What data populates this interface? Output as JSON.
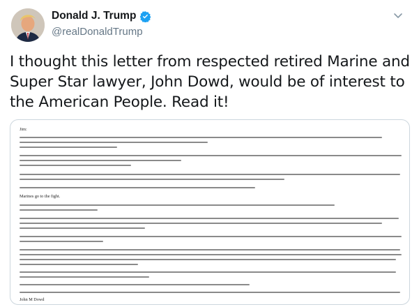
{
  "tweet": {
    "display_name": "Donald J. Trump",
    "handle": "@realDonaldTrump",
    "text": "I thought this letter from respected retired Marine and Super Star lawyer, John Dowd, would be of interest to the American People. Read it!"
  },
  "letter": {
    "salutation": "Jim:",
    "fight_line": "Marines go to the fight.",
    "signature": "John M Dowd"
  },
  "colors": {
    "verified": "#1da1f2",
    "handle": "#657786",
    "border": "#ccd6dd"
  },
  "icons": {
    "verified": "verified-badge-icon",
    "menu": "chevron-down-icon"
  }
}
